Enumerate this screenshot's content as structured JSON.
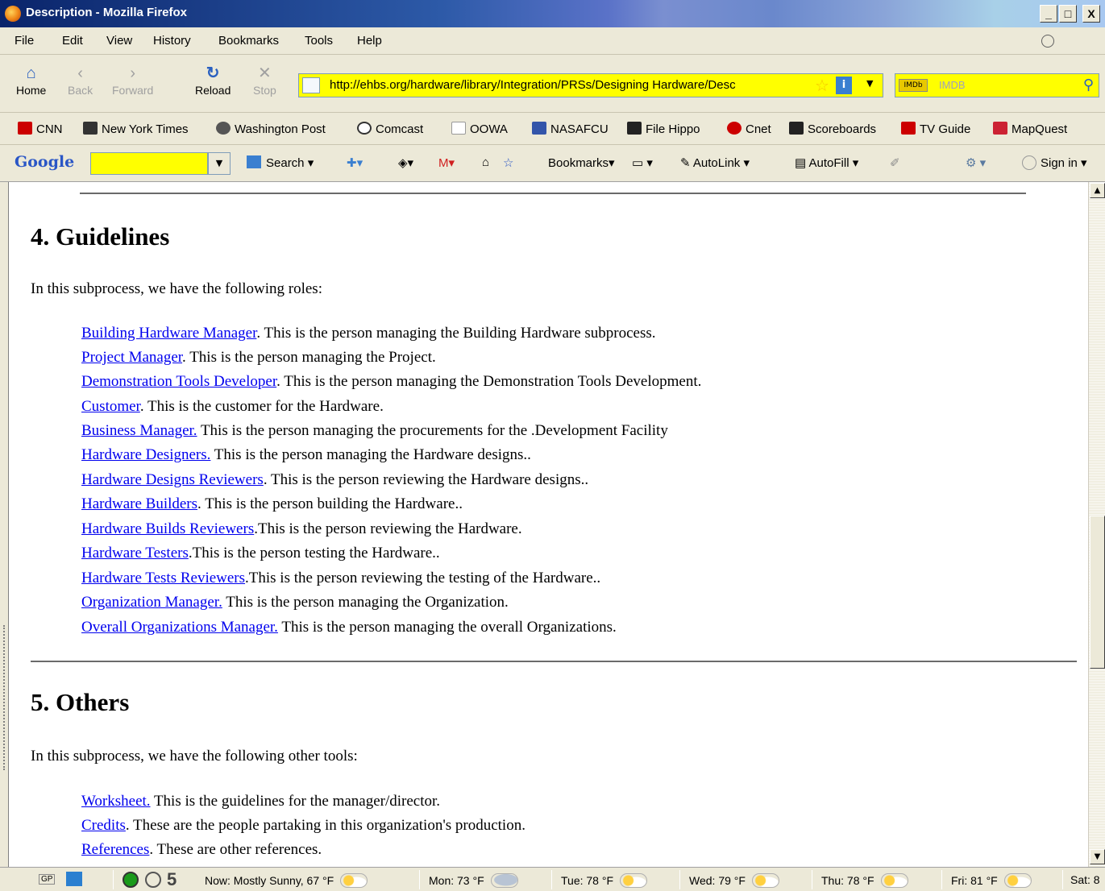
{
  "window": {
    "title": "Description - Mozilla Firefox",
    "min": "_",
    "max": "□",
    "close": "X"
  },
  "menu": [
    {
      "label": "File"
    },
    {
      "label": "Edit"
    },
    {
      "label": "View"
    },
    {
      "label": "History"
    },
    {
      "label": "Bookmarks"
    },
    {
      "label": "Tools"
    },
    {
      "label": "Help"
    }
  ],
  "nav": {
    "home": "Home",
    "back": "Back",
    "forward": "Forward",
    "reload": "Reload",
    "stop": "Stop",
    "url": "http://ehbs.org/hardware/library/Integration/PRSs/Designing Hardware/Desc",
    "search_placeholder": "IMDB"
  },
  "bookmarks": [
    {
      "label": "CNN",
      "color": "#cc0000"
    },
    {
      "label": "New York Times",
      "color": "#333333"
    },
    {
      "label": "Washington Post",
      "color": "#555555"
    },
    {
      "label": "Comcast",
      "color": "#444444"
    },
    {
      "label": "OOWA",
      "color": "#dddddd"
    },
    {
      "label": "NASAFCU",
      "color": "#3355aa"
    },
    {
      "label": "File Hippo",
      "color": "#222222"
    },
    {
      "label": "Cnet",
      "color": "#cc0000"
    },
    {
      "label": "Scoreboards",
      "color": "#222222"
    },
    {
      "label": "TV Guide",
      "color": "#cc0000"
    },
    {
      "label": "MapQuest",
      "color": "#cc2233"
    }
  ],
  "google_toolbar": {
    "logo": "Google",
    "search": "Search",
    "bookmarks": "Bookmarks",
    "autolink": "AutoLink",
    "autofill": "AutoFill",
    "signin": "Sign in"
  },
  "content": {
    "section4": {
      "heading": "4. Guidelines",
      "intro": "In this subprocess, we have the following roles:",
      "roles": [
        {
          "link": "Building Hardware Manager",
          "text": ". This is the person managing the Building Hardware subprocess."
        },
        {
          "link": "Project Manager",
          "text": ". This is the person managing the Project."
        },
        {
          "link": "Demonstration Tools Developer",
          "text": ". This is the person managing the Demonstration Tools Development."
        },
        {
          "link": "Customer",
          "text": ". This is the customer for the Hardware."
        },
        {
          "link": "Business Manager.",
          "text": " This is the person managing the procurements for the .Development Facility"
        },
        {
          "link": "Hardware Designers.",
          "text": " This is the person managing the Hardware designs.."
        },
        {
          "link": "Hardware Designs Reviewers",
          "text": ". This is the person reviewing the Hardware designs.."
        },
        {
          "link": "Hardware Builders",
          "text": ". This is the person building the Hardware.."
        },
        {
          "link": "Hardware Builds Reviewers",
          "text": ".This is the person reviewing the Hardware."
        },
        {
          "link": "Hardware Testers",
          "text": ".This is the person testing the Hardware.."
        },
        {
          "link": "Hardware Tests Reviewers",
          "text": ".This is the person reviewing the testing of the Hardware.."
        },
        {
          "link": "Organization Manager.",
          "text": " This is the person managing the Organization."
        },
        {
          "link": "Overall Organizations Manager.",
          "text": " This is the person managing the overall Organizations."
        }
      ]
    },
    "section5": {
      "heading": "5. Others",
      "intro": "In this subprocess, we have the following other tools:",
      "tools": [
        {
          "link": "Worksheet.",
          "text": " This is the guidelines for the manager/director."
        },
        {
          "link": "Credits",
          "text": ". These are the people partaking in this organization's production."
        },
        {
          "link": "References",
          "text": ". These are other references."
        }
      ]
    }
  },
  "status": {
    "gp": "GP",
    "num": "5",
    "now": "Now: Mostly Sunny, 67 °F",
    "mon": "Mon: 73 °F",
    "tue": "Tue: 78 °F",
    "wed": "Wed: 79 °F",
    "thu": "Thu: 78 °F",
    "fri": "Fri: 81 °F",
    "sat": "Sat: 8"
  }
}
